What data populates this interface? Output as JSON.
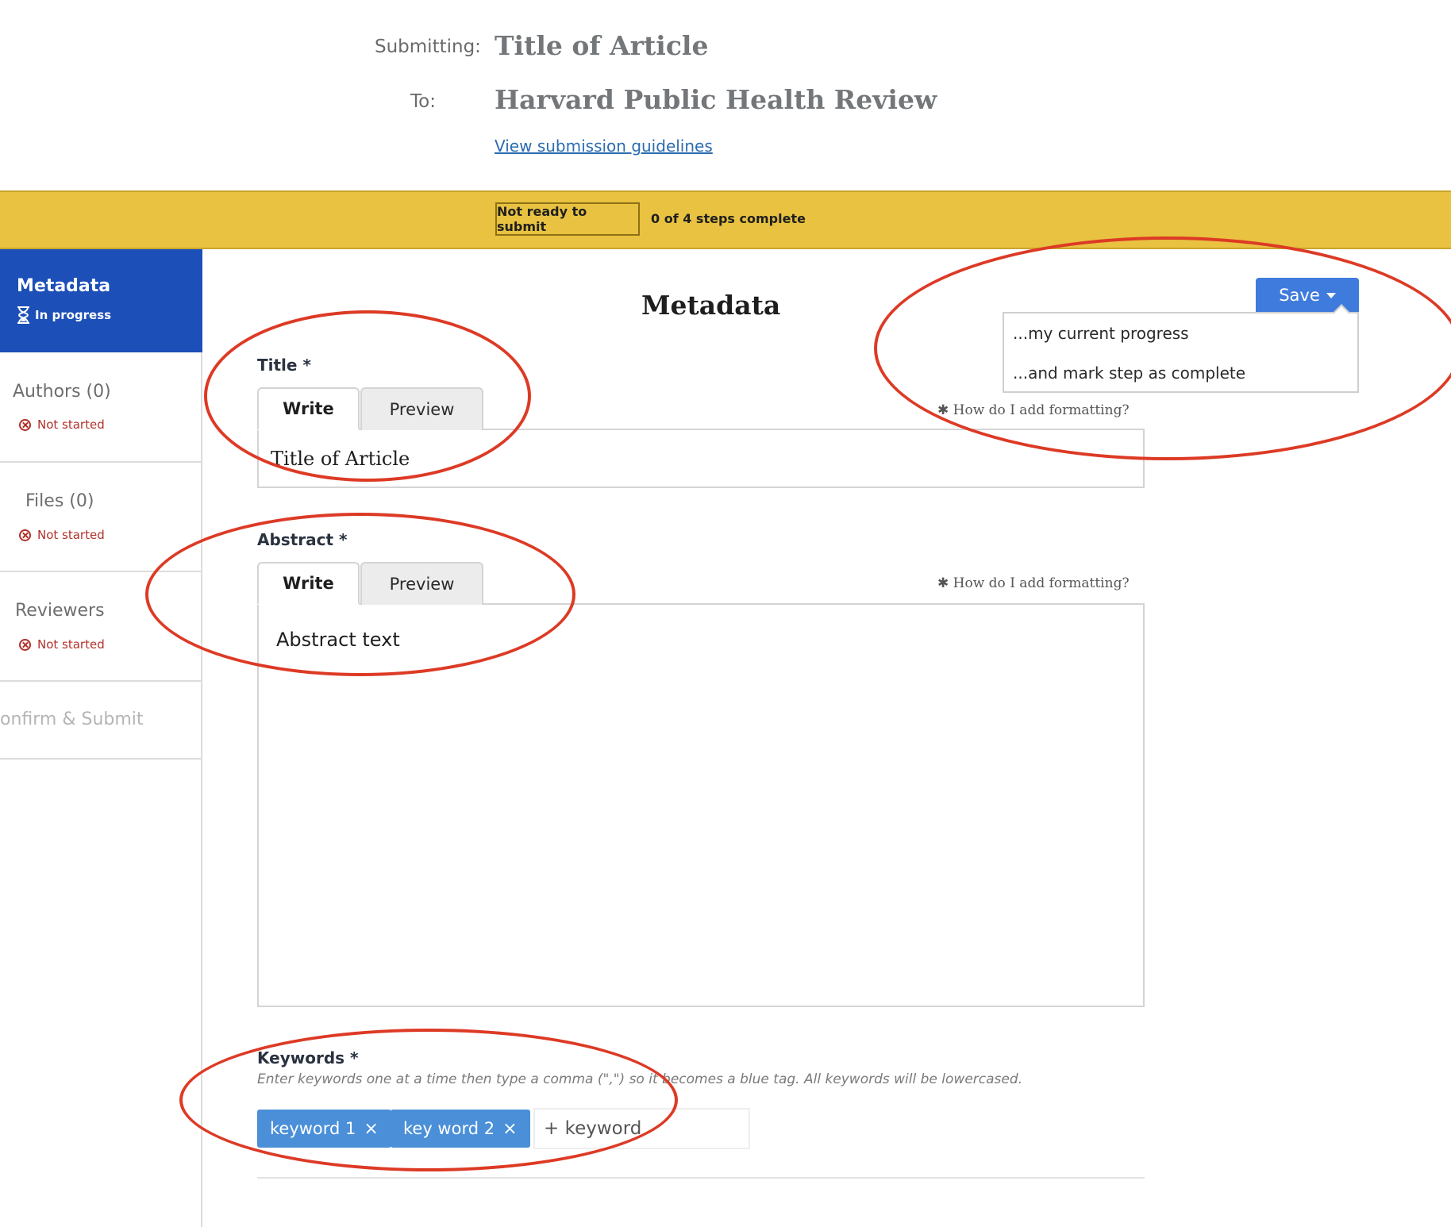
{
  "header": {
    "submitting_label": "Submitting:",
    "submitting_value": "Title of Article",
    "to_label": "To:",
    "to_value": "Harvard Public Health Review",
    "guidelines_link": "View submission guidelines"
  },
  "status_bar": {
    "badge": "Not ready to submit",
    "steps": "0 of 4  steps complete",
    "color": "#e8c240"
  },
  "sidebar": {
    "active": {
      "label": "Metadata",
      "status": "In progress",
      "color": "#1c4fb8"
    },
    "items": [
      {
        "label": "Authors (0)",
        "status": "Not started"
      },
      {
        "label": "Files (0)",
        "status": "Not started"
      },
      {
        "label": "Reviewers",
        "status": "Not started"
      },
      {
        "label": "onfirm & Submit"
      }
    ]
  },
  "main": {
    "title": "Metadata",
    "save": {
      "label": "Save",
      "options": [
        "...my current progress",
        "...and mark step as complete"
      ],
      "color": "#3f7bdc"
    },
    "format_help": "How do I add formatting?",
    "title_field": {
      "label": "Title *",
      "tabs": [
        "Write",
        "Preview"
      ],
      "value": "Title of Article"
    },
    "abstract_field": {
      "label": "Abstract *",
      "tabs": [
        "Write",
        "Preview"
      ],
      "value": "Abstract text"
    },
    "keywords_field": {
      "label": "Keywords *",
      "hint": "Enter keywords one at a time then type a comma (\",\") so it becomes a blue tag. All keywords will be lowercased.",
      "tags": [
        "keyword 1",
        "key word 2"
      ],
      "placeholder": "+ keyword",
      "tag_color": "#4a8fd8"
    }
  },
  "annotation_color": "#dd3a25"
}
